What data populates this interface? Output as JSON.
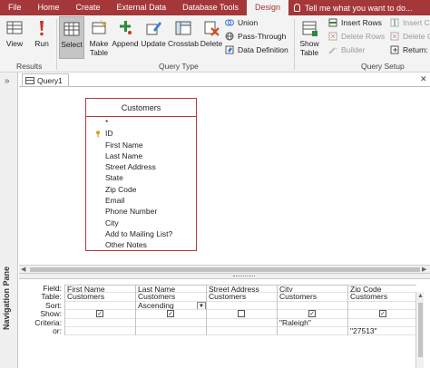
{
  "ribbon_tabs": [
    "File",
    "Home",
    "Create",
    "External Data",
    "Database Tools",
    "Design"
  ],
  "tell_me_placeholder": "Tell me what you want to do...",
  "results_group": {
    "label": "Results",
    "view": "View",
    "run": "Run"
  },
  "query_type_group": {
    "label": "Query Type",
    "select": "Select",
    "make_table": "Make Table",
    "append": "Append",
    "update": "Update",
    "crosstab": "Crosstab",
    "delete": "Delete",
    "union": "Union",
    "pass_through": "Pass-Through",
    "data_definition": "Data Definition"
  },
  "query_setup_group": {
    "label": "Query Setup",
    "show_table": "Show Table",
    "insert_rows": "Insert Rows",
    "delete_rows": "Delete Rows",
    "builder": "Builder",
    "insert_columns": "Insert C",
    "delete_columns": "Delete C",
    "return": "Return:"
  },
  "navigation_pane_label": "Navigation Pane",
  "document_tab": "Query1",
  "table": {
    "title": "Customers",
    "fields": [
      "*",
      "ID",
      "First Name",
      "Last Name",
      "Street Address",
      "State",
      "Zip Code",
      "Email",
      "Phone Number",
      "City",
      "Add to Mailing List?",
      "Other Notes"
    ]
  },
  "grid": {
    "row_labels": [
      "Field:",
      "Table:",
      "Sort:",
      "Show:",
      "Criteria:",
      "or:"
    ],
    "columns": [
      {
        "field": "First Name",
        "table": "Customers",
        "sort": "",
        "show": true,
        "criteria": "",
        "or": ""
      },
      {
        "field": "Last Name",
        "table": "Customers",
        "sort": "Ascending",
        "show": true,
        "criteria": "",
        "or": ""
      },
      {
        "field": "Street Address",
        "table": "Customers",
        "sort": "",
        "show": false,
        "criteria": "",
        "or": ""
      },
      {
        "field": "City",
        "table": "Customers",
        "sort": "",
        "show": true,
        "criteria": "\"Raleigh\"",
        "or": ""
      },
      {
        "field": "Zip Code",
        "table": "Customers",
        "sort": "",
        "show": true,
        "criteria": "",
        "or": "\"27513\""
      }
    ]
  },
  "colors": {
    "accent": "#a4373a",
    "table_border": "#b83a3a"
  }
}
